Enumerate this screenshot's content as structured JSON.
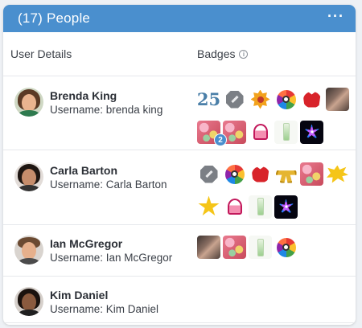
{
  "panel": {
    "title": "(17) People",
    "more_label": "···"
  },
  "columns": {
    "user_details": "User Details",
    "badges": "Badges",
    "info_icon": "i"
  },
  "colors": {
    "header": "#4a8fce",
    "count_badge": "#4a8fce"
  },
  "people": [
    {
      "name": "Brenda King",
      "username": "Username: brenda king",
      "badges": [
        "25-badge",
        "gray-octagon-badge",
        "gold-flower-badge",
        "rainbow-flower-badge",
        "red-rose-badge",
        "photo-badge",
        "candy-badge",
        "candy-badge",
        "cake-badge",
        "glass-badge",
        "purple-burst-badge"
      ],
      "extra_count": "2",
      "badge_text_25": "25"
    },
    {
      "name": "Carla Barton",
      "username": "Username: Carla Barton",
      "badges": [
        "gray-octagon-badge",
        "rainbow-flower-badge",
        "red-rose-badge",
        "gold-belt-badge",
        "candy-badge",
        "bam-badge",
        "star-badge",
        "cake-badge",
        "glass-badge",
        "purple-burst-badge"
      ]
    },
    {
      "name": "Ian McGregor",
      "username": "Username: Ian McGregor",
      "badges": [
        "photo-badge",
        "candy-badge",
        "glass-badge",
        "rainbow-flower-badge"
      ]
    },
    {
      "name": "Kim Daniel",
      "username": "Username: Kim Daniel",
      "badges": []
    }
  ]
}
